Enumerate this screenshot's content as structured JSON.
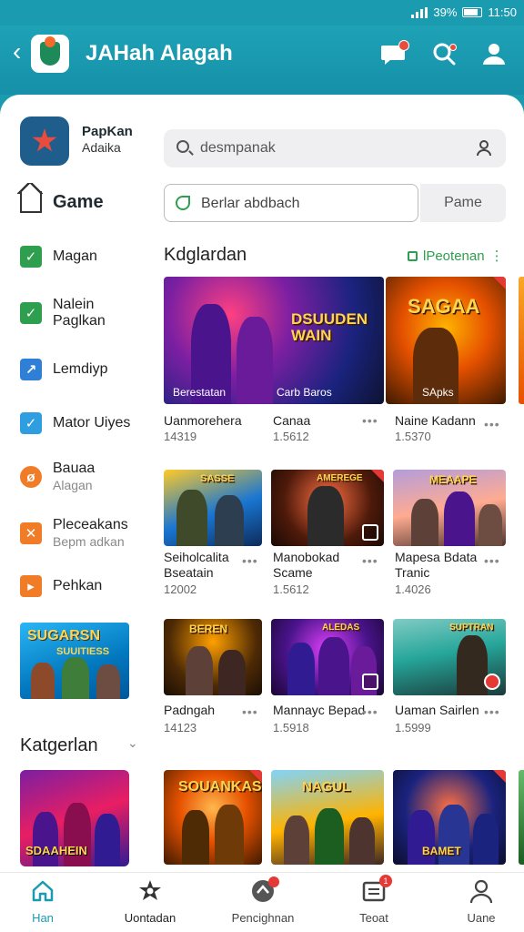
{
  "status_bar": {
    "battery": "39%",
    "time": "11:50"
  },
  "header": {
    "title": "JAHah Alagah"
  },
  "sidebar": {
    "app_name": "PapKan",
    "app_sub": "Adaika",
    "game_label": "Game",
    "items": [
      {
        "label": "Magan",
        "sub": "",
        "icon": "check-square-icon",
        "color": "#2e9e4f"
      },
      {
        "label": "Nalein",
        "sub": "Paglkan",
        "icon": "check-icon",
        "color": "#2e9e4f"
      },
      {
        "label": "Lemdiyp",
        "sub": "",
        "icon": "chart-icon",
        "color": "#2f7fd6"
      },
      {
        "label": "Mator Uiyes",
        "sub": "",
        "icon": "check-icon",
        "color": "#2f9ee0"
      },
      {
        "label": "Bauaa",
        "sub": "Alagan",
        "icon": "wrench-icon",
        "color": "#f07c28"
      },
      {
        "label": "Pleceakans",
        "sub": "Bepm adkan",
        "icon": "cross-icon",
        "color": "#f07c28"
      },
      {
        "label": "Pehkan",
        "sub": "",
        "icon": "play-icon",
        "color": "#f07c28"
      }
    ],
    "promo_title": "SUGARSN",
    "promo_sub": "SUUITIESS",
    "categories_label": "Katgerlan",
    "category_card_title": "SDAAHEIN"
  },
  "search": {
    "value": "desmpanak"
  },
  "filter": {
    "value": "Berlar abdbach",
    "button": "Pame"
  },
  "section": {
    "title": "Kdglardan",
    "link": "lPeotenan"
  },
  "featured": [
    {
      "art_title": "DSUUDEN WAIN",
      "caption": "Berestatan",
      "sub_caption": "Carb Baros"
    },
    {
      "art_title": "SAGAA",
      "caption": "SApks"
    }
  ],
  "featured_meta": [
    {
      "title": "Uanmorehera",
      "count": "14319"
    },
    {
      "title": "Canaa",
      "count": "1.5612"
    },
    {
      "title": "Naine Kadann",
      "count": "1.5370"
    }
  ],
  "games": [
    {
      "title": "Seiholcalita",
      "title2": "Bseatain",
      "count": "12002",
      "art": "SASSE"
    },
    {
      "title": "Manobokad",
      "title2": "Scame",
      "count": "1.5612",
      "art": "AMEREGE"
    },
    {
      "title": "Mapesa Bdata",
      "title2": "Tranic",
      "count": "1.4026",
      "art": "MEAAPE"
    },
    {
      "title": "Padngah",
      "title2": "",
      "count": "14123",
      "art": "BEREN"
    },
    {
      "title": "Mannayc Bepad",
      "title2": "",
      "count": "1.5918",
      "art": "ALEDAS"
    },
    {
      "title": "Uaman Sairlen",
      "title2": "",
      "count": "1.5999",
      "art": "SUPTRAN"
    },
    {
      "title": "",
      "title2": "",
      "count": "",
      "art": "SOUANKAS"
    },
    {
      "title": "",
      "title2": "",
      "count": "",
      "art": "NAGUL"
    },
    {
      "title": "",
      "title2": "",
      "count": "",
      "art": "BAMET"
    }
  ],
  "bottom_nav": [
    {
      "label": "Han",
      "icon": "home-icon",
      "active": true
    },
    {
      "label": "Uontadan",
      "icon": "star-gear-icon",
      "active": false
    },
    {
      "label": "Pencighnan",
      "icon": "gamepad-icon",
      "active": false
    },
    {
      "label": "Teoat",
      "icon": "inbox-icon",
      "badge": "1",
      "active": false
    },
    {
      "label": "Uane",
      "icon": "user-icon",
      "active": false
    }
  ],
  "colors": {
    "header": "#1a9bb0",
    "accent": "#2e9e4f",
    "badge": "#e53935"
  }
}
